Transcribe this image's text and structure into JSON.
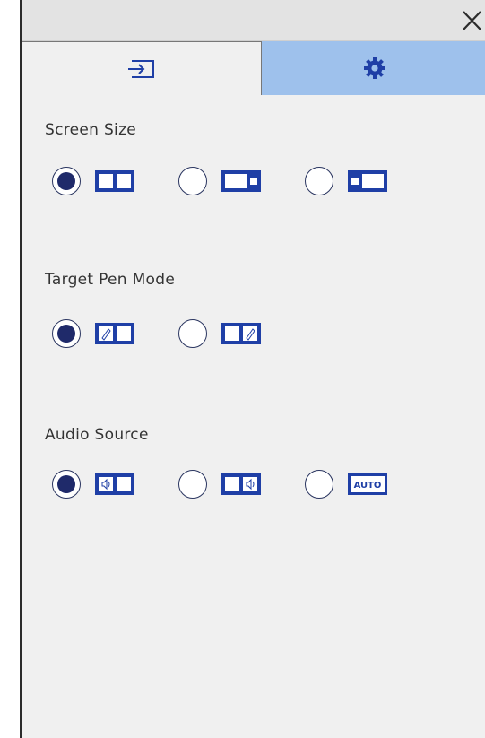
{
  "window": {
    "close_icon": "close-icon"
  },
  "tabs": [
    {
      "name": "input",
      "icon": "input-icon",
      "selected": false
    },
    {
      "name": "settings",
      "icon": "gear-icon",
      "selected": true
    }
  ],
  "colors": {
    "accent": "#1f3fa6",
    "selected_tab": "#9ec1ec",
    "radio_fill": "#1f2a6a"
  },
  "sections": {
    "screen_size": {
      "title": "Screen Size",
      "options": [
        {
          "icon": "split-equal-icon",
          "selected": true
        },
        {
          "icon": "split-left-large-icon",
          "selected": false
        },
        {
          "icon": "split-right-large-icon",
          "selected": false
        }
      ]
    },
    "target_pen_mode": {
      "title": "Target Pen Mode",
      "options": [
        {
          "icon": "pen-left-icon",
          "selected": true
        },
        {
          "icon": "pen-right-icon",
          "selected": false
        }
      ]
    },
    "audio_source": {
      "title": "Audio Source",
      "options": [
        {
          "icon": "speaker-left-icon",
          "selected": true
        },
        {
          "icon": "speaker-right-icon",
          "selected": false
        },
        {
          "icon": "auto-icon",
          "label": "AUTO",
          "selected": false
        }
      ]
    }
  }
}
